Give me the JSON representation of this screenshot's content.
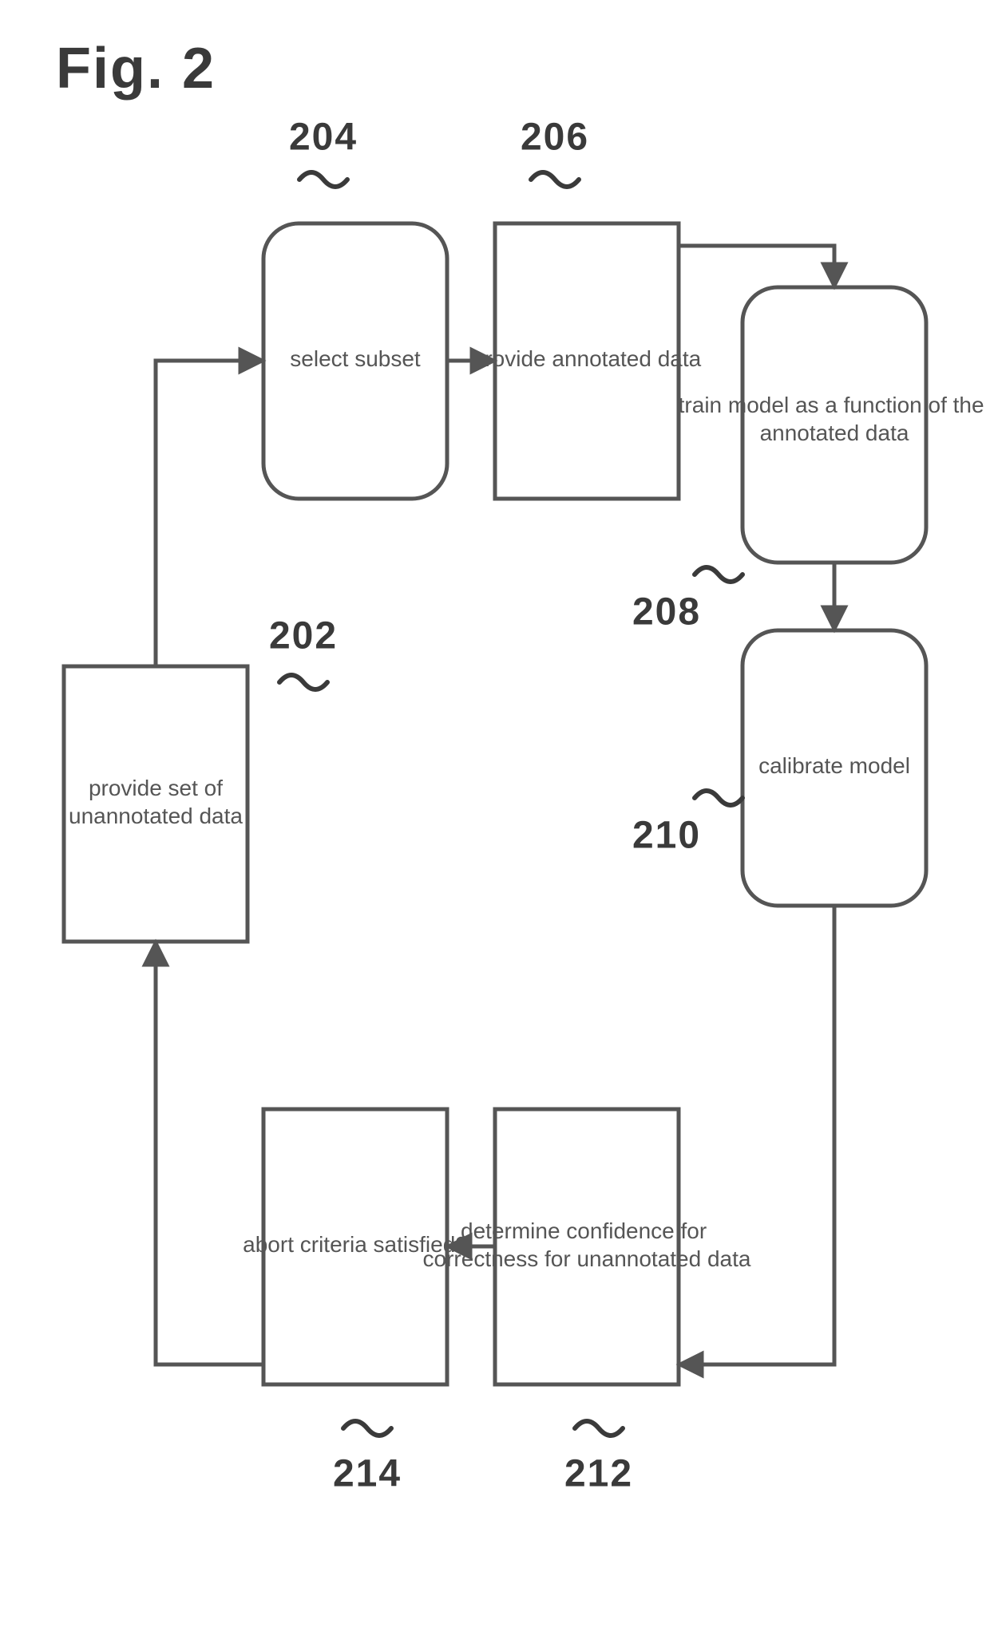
{
  "figure_label": "Fig. 2",
  "nodes": {
    "n202": {
      "ref": "202",
      "text": [
        "provide set of",
        "unannotated data"
      ]
    },
    "n204": {
      "ref": "204",
      "text": [
        "select subset"
      ]
    },
    "n206": {
      "ref": "206",
      "text": [
        "provide annotated data"
      ]
    },
    "n208": {
      "ref": "208",
      "text": [
        "train model as a function of the",
        "annotated data"
      ]
    },
    "n210": {
      "ref": "210",
      "text": [
        "calibrate model"
      ]
    },
    "n212": {
      "ref": "212",
      "text": [
        "determine confidence for",
        "correctness for unannotated data"
      ]
    },
    "n214": {
      "ref": "214",
      "text": [
        "abort criteria satisfied?"
      ]
    }
  },
  "flow_edges": [
    [
      "n202",
      "n204"
    ],
    [
      "n204",
      "n206"
    ],
    [
      "n206",
      "n208"
    ],
    [
      "n208",
      "n210"
    ],
    [
      "n210",
      "n212"
    ],
    [
      "n212",
      "n214"
    ],
    [
      "n214",
      "n202"
    ]
  ]
}
